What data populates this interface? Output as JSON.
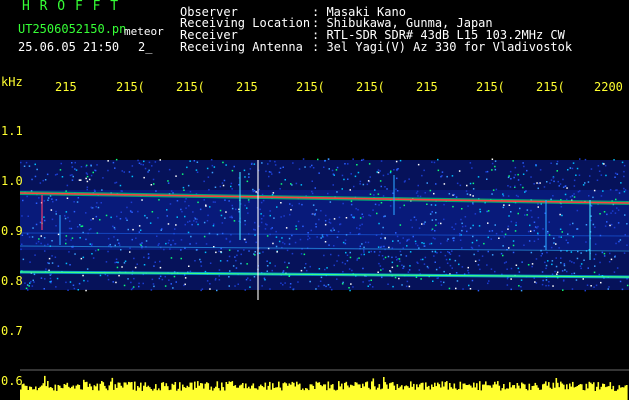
{
  "app": {
    "name": "H R O F F T",
    "file": "UT2506052150.pn",
    "mode": "meteor",
    "datetime": "25.06.05 21:50",
    "counter": "2_"
  },
  "info": {
    "rows": [
      {
        "label": "Observer",
        "value": ": Masaki Kano"
      },
      {
        "label": "Receiving Location",
        "value": ": Shibukawa, Gunma, Japan"
      },
      {
        "label": "Receiver",
        "value": ": RTL-SDR SDR# 43dB L15 103.2MHz CW"
      },
      {
        "label": "Receiving Antenna",
        "value": ": 3el Yagi(V) Az 330 for Vladivostok"
      }
    ]
  },
  "axes": {
    "unit": "kHz",
    "time_labels": [
      "215",
      "215(",
      "215(",
      "215",
      "215(",
      "215(",
      "215",
      "215(",
      "215(",
      "2200"
    ],
    "freq_labels": [
      "1.1",
      "1.0",
      "0.9",
      "0.8",
      "0.7",
      "0.6"
    ]
  },
  "colors": {
    "background": "#000000",
    "spectrum_base": "#06125a",
    "title_green": "#36ff36",
    "axis_yellow": "#ffff30",
    "echo_line": "#ff4040"
  }
}
